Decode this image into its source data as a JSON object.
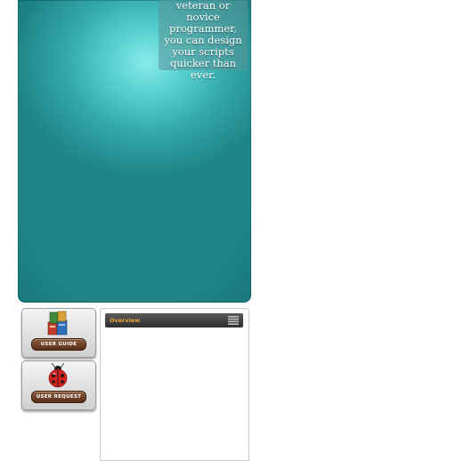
{
  "hero": {
    "caption": "veteran or novice programmer, you can design your scripts quicker than ever."
  },
  "sidebar": {
    "buttons": [
      {
        "label": "User Guide",
        "icon": "books-icon"
      },
      {
        "label": "User Request",
        "icon": "ladybug-icon"
      }
    ]
  },
  "panel": {
    "title": "Overview",
    "icon": "menu-list-icon"
  },
  "colors": {
    "hero_teal": "#33a9ac",
    "panel_title": "#f0a23a",
    "button_label_bg": "#6b3d22"
  }
}
